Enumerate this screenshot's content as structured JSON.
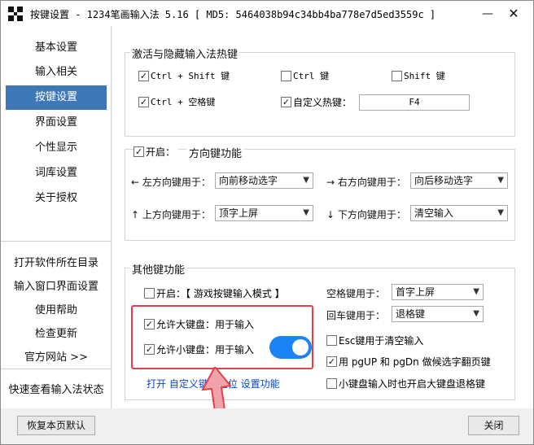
{
  "window": {
    "title": "按键设置 - 1234笔画输入法 5.16  [ MD5: 5464038b94c34bb4ba778e7d5ed3559c ]",
    "minimize_label": "—",
    "close_label": "✕"
  },
  "sidebar": {
    "items": [
      {
        "label": "基本设置"
      },
      {
        "label": "输入相关"
      },
      {
        "label": "按键设置"
      },
      {
        "label": "界面设置"
      },
      {
        "label": "个性显示"
      },
      {
        "label": "词库设置"
      },
      {
        "label": "关于授权"
      }
    ],
    "active_index": 2,
    "links": [
      {
        "label": "打开软件所在目录"
      },
      {
        "label": "输入窗口界面设置"
      },
      {
        "label": "使用帮助"
      },
      {
        "label": "检查更新"
      },
      {
        "label": "官方网站 >>"
      }
    ],
    "status_link": "快速查看输入法状态"
  },
  "hotkeys": {
    "title": "激活与隐藏输入法热键",
    "options": [
      {
        "label": "Ctrl + Shift 键",
        "checked": true
      },
      {
        "label": "Ctrl 键",
        "checked": false
      },
      {
        "label": "Shift 键",
        "checked": false
      },
      {
        "label": "Ctrl + 空格键",
        "checked": true
      },
      {
        "label": "自定义热键：",
        "checked": true
      }
    ],
    "custom_value": "F4"
  },
  "arrows": {
    "enable_label": "开启：",
    "enabled": true,
    "title": "方向键功能",
    "rows": [
      {
        "label": "← 左方向键用于：",
        "value": "向前移动选字"
      },
      {
        "label": "→ 右方向键用于：",
        "value": "向后移动选字"
      },
      {
        "label": "↑ 上方向键用于：",
        "value": "顶字上屏"
      },
      {
        "label": "↓ 下方向键用于：",
        "value": "清空输入"
      }
    ]
  },
  "other": {
    "title": "其他键功能",
    "game_mode": {
      "label": "开启：【 游戏按键输入模式 】",
      "checked": false
    },
    "space_label": "空格键用于：",
    "space_value": "首字上屏",
    "enter_label": "回车键用于：",
    "enter_value": "退格键",
    "allow_main_kb": {
      "label": "允许大键盘：用于输入",
      "checked": true
    },
    "allow_numpad": {
      "label": "允许小键盘：用于输入",
      "checked": true
    },
    "esc_clear": {
      "label": "Esc键用于清空输入",
      "checked": false
    },
    "pgup_pgdn": {
      "label": "用 pgUP 和 pgDn 做候选字翻页键",
      "checked": true
    },
    "numpad_backspace": {
      "label": "小键盘输入时也开启大键盘退格键",
      "checked": false
    },
    "open_custom_link": "打开 自定义键盘定位 设置功能",
    "toggle_on": true
  },
  "footer": {
    "restore_label": "恢复本页默认",
    "close_label": "关闭"
  },
  "colors": {
    "accent": "#3e78b8",
    "toggle": "#1a83f5",
    "highlight": "#e0414b",
    "link": "#0a47c2"
  }
}
